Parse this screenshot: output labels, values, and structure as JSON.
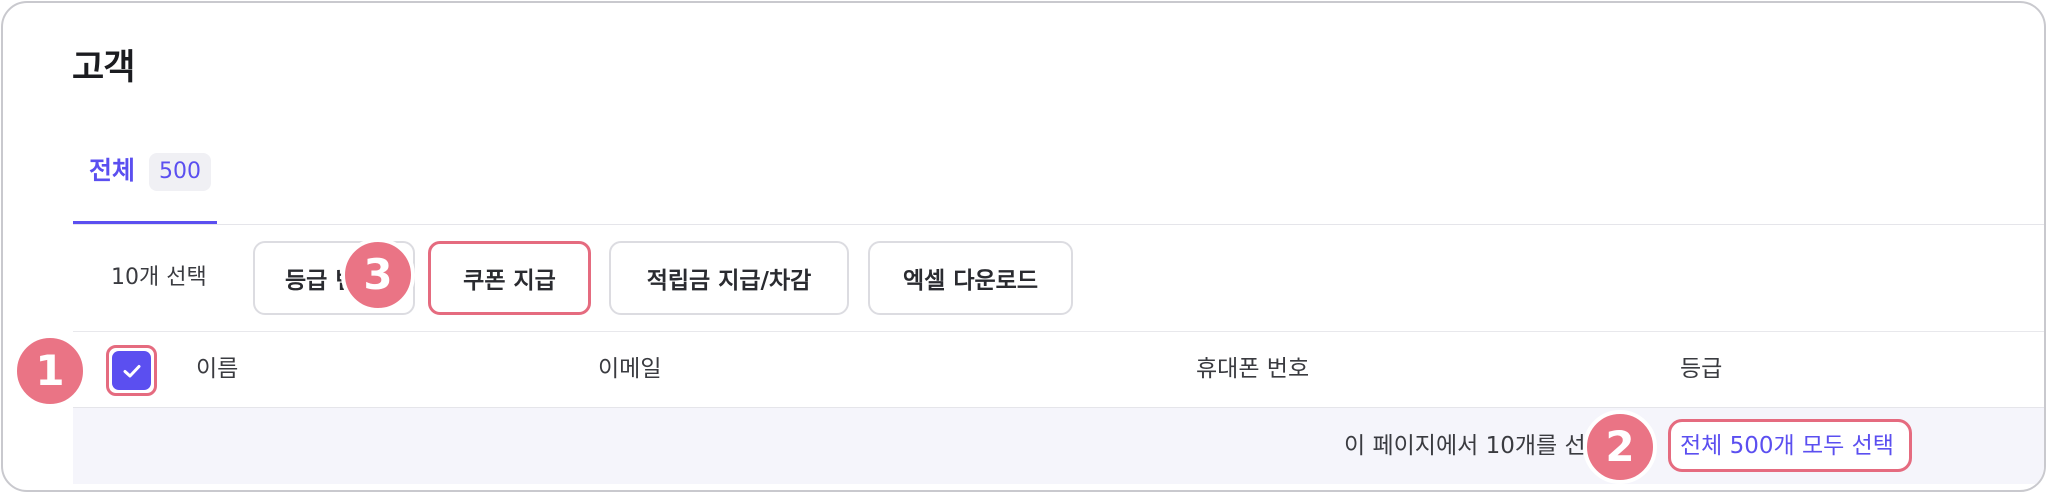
{
  "page": {
    "title": "고객"
  },
  "tabs": [
    {
      "label": "전체",
      "count": "500"
    }
  ],
  "toolbar": {
    "selected_text": "10개 선택",
    "buttons": {
      "grade": "등급 변",
      "coupon": "쿠폰 지급",
      "points": "적립금 지급/차감",
      "excel": "엑셀 다운로드"
    }
  },
  "table": {
    "columns": {
      "name": "이름",
      "email": "이메일",
      "phone": "휴대폰 번호",
      "grade": "등급"
    },
    "select_all_checked": true
  },
  "notice": {
    "text": "이 페이지에서 10개를 선택했어요",
    "select_all_link": "전체 500개 모두 선택"
  },
  "markers": {
    "one": "1",
    "two": "2",
    "three": "3"
  },
  "colors": {
    "accent": "#5b4ff0",
    "highlight": "#e56b7f",
    "marker": "#ea7485",
    "notice_bg": "#f5f5fb"
  }
}
